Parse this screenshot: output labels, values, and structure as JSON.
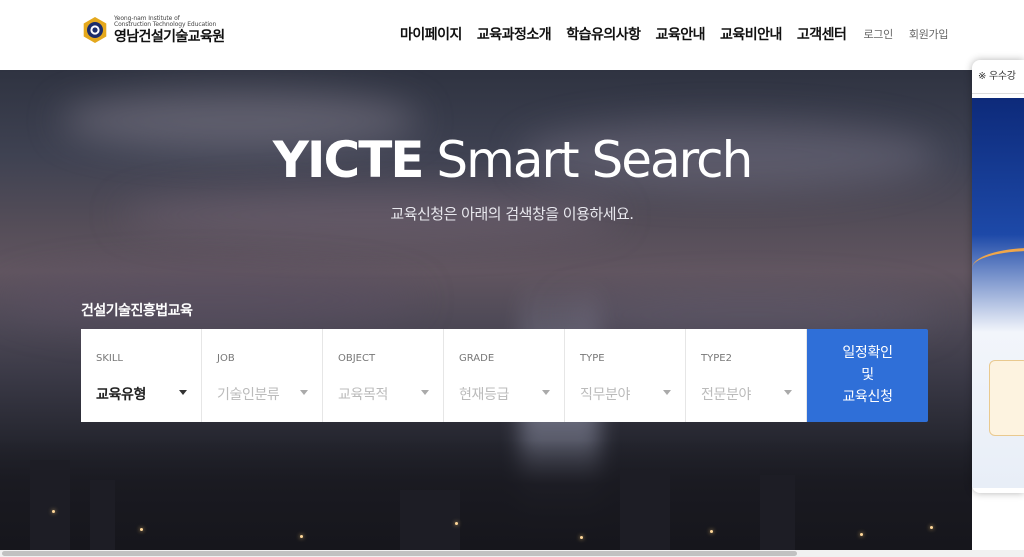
{
  "logo": {
    "subtitle_line1": "Yeong-nam Institute of",
    "subtitle_line2": "Construction Technology Education",
    "name": "영남건설기술교육원"
  },
  "nav": {
    "items": [
      {
        "label": "마이페이지"
      },
      {
        "label": "교육과정소개"
      },
      {
        "label": "학습유의사항"
      },
      {
        "label": "교육안내"
      },
      {
        "label": "교육비안내"
      },
      {
        "label": "고객센터"
      }
    ],
    "login": "로그인",
    "signup": "회원가입"
  },
  "hero": {
    "title_bold": "YICTE",
    "title_rest": "Smart Search",
    "subtitle": "교육신청은 아래의 검색창을 이용하세요."
  },
  "search": {
    "section_label": "건설기술진흥법교육",
    "fields": [
      {
        "label": "SKILL",
        "value": "교육유형"
      },
      {
        "label": "JOB",
        "value": "기술인분류"
      },
      {
        "label": "OBJECT",
        "value": "교육목적"
      },
      {
        "label": "GRADE",
        "value": "현재등급"
      },
      {
        "label": "TYPE",
        "value": "직무분야"
      },
      {
        "label": "TYPE2",
        "value": "전문분야"
      }
    ],
    "button_line1": "일정확인",
    "button_line2": "및",
    "button_line3": "교육신청"
  },
  "side_panel": {
    "top_text": "※ 우수강"
  },
  "colors": {
    "accent": "#2f6fd8",
    "logo_gold": "#e4a81d",
    "logo_navy": "#1b2d6b"
  }
}
